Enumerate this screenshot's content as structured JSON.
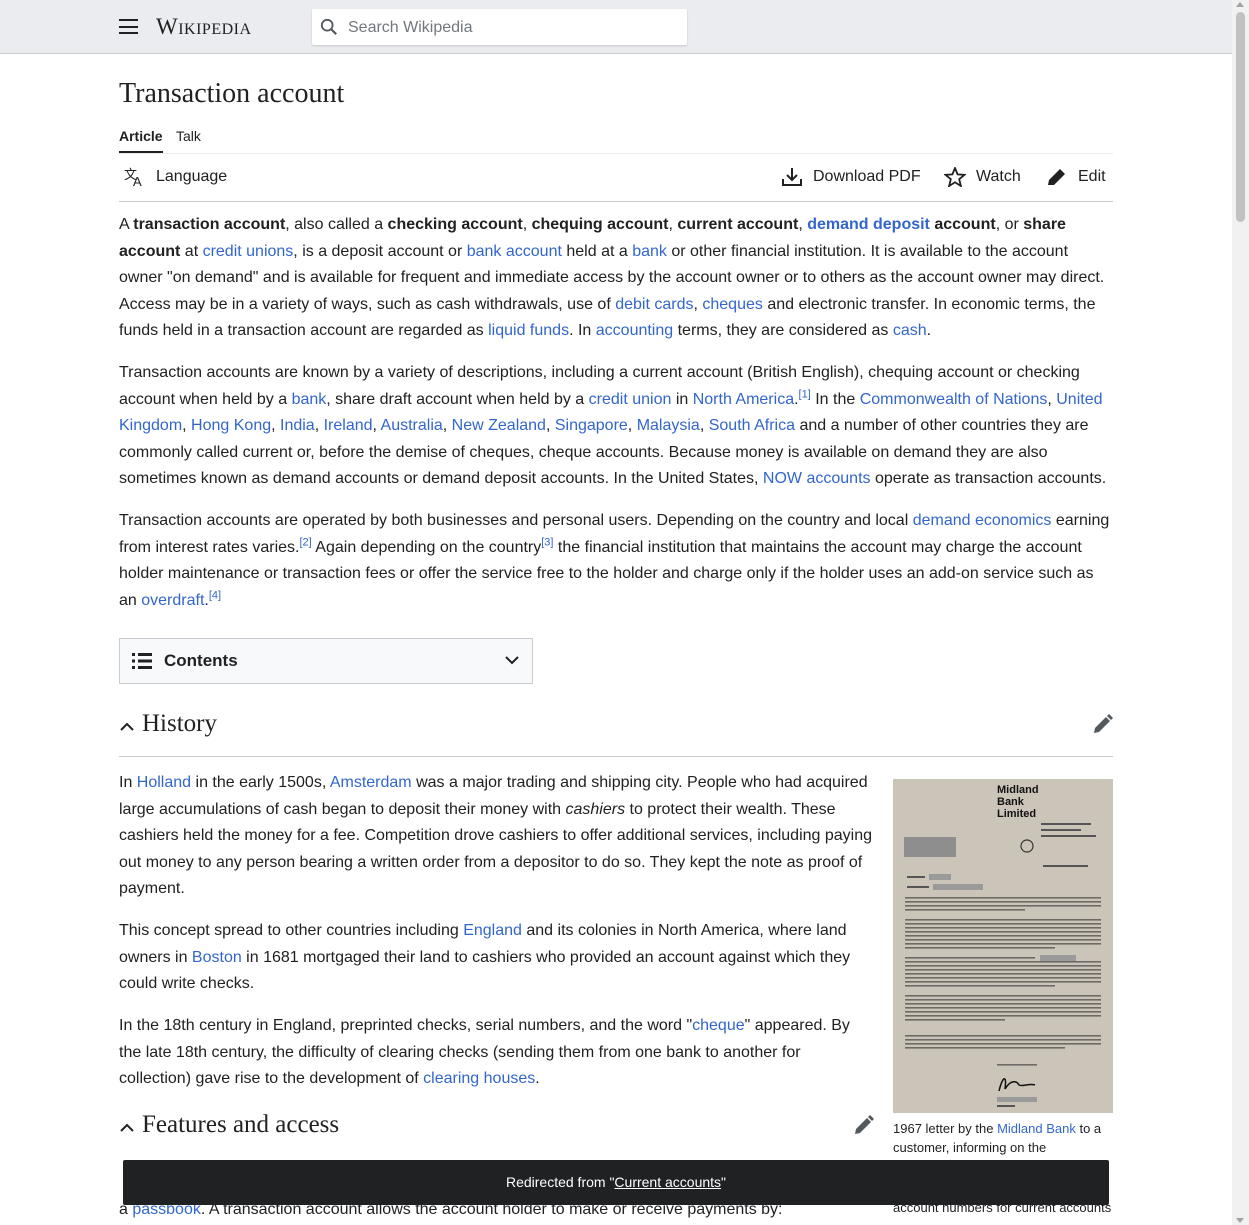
{
  "header": {
    "logo": "Wikipedia",
    "search_placeholder": "Search Wikipedia"
  },
  "page": {
    "title": "Transaction account",
    "tabs": [
      "Article",
      "Talk"
    ],
    "actions": {
      "language": "Language",
      "download": "Download PDF",
      "watch": "Watch",
      "edit": "Edit"
    }
  },
  "intro": {
    "p1": [
      {
        "t": "A "
      },
      {
        "t": "transaction account",
        "b": true
      },
      {
        "t": ", also called a "
      },
      {
        "t": "checking account",
        "b": true
      },
      {
        "t": ", "
      },
      {
        "t": "chequing account",
        "b": true
      },
      {
        "t": ", "
      },
      {
        "t": "current account",
        "b": true
      },
      {
        "t": ", "
      },
      {
        "t": "demand deposit",
        "b": true,
        "l": true
      },
      {
        "t": " account",
        "b": true
      },
      {
        "t": ", or "
      },
      {
        "t": "share account",
        "b": true
      },
      {
        "t": " at "
      },
      {
        "t": "credit unions",
        "l": true
      },
      {
        "t": ", is a deposit account or "
      },
      {
        "t": "bank account",
        "l": true
      },
      {
        "t": " held at a "
      },
      {
        "t": "bank",
        "l": true
      },
      {
        "t": " or other financial institution. It is available to the account owner \"on demand\" and is available for frequent and immediate access by the account owner or to others as the account owner may direct. Access may be in a variety of ways, such as cash withdrawals, use of "
      },
      {
        "t": "debit cards",
        "l": true
      },
      {
        "t": ", "
      },
      {
        "t": "cheques",
        "l": true
      },
      {
        "t": " and electronic transfer. In economic terms, the funds held in a transaction account are regarded as "
      },
      {
        "t": "liquid funds",
        "l": true
      },
      {
        "t": ". In "
      },
      {
        "t": "accounting",
        "l": true
      },
      {
        "t": " terms, they are considered as "
      },
      {
        "t": "cash",
        "l": true
      },
      {
        "t": "."
      }
    ],
    "p2": [
      {
        "t": "Transaction accounts are known by a variety of descriptions, including a current account (British English), chequing account or checking account when held by a "
      },
      {
        "t": "bank",
        "l": true
      },
      {
        "t": ", share draft account when held by a "
      },
      {
        "t": "credit union",
        "l": true
      },
      {
        "t": " in "
      },
      {
        "t": "North America",
        "l": true
      },
      {
        "t": ".",
        "s": false
      },
      {
        "t": "[1]",
        "sup": true
      },
      {
        "t": " In the "
      },
      {
        "t": "Commonwealth of Nations",
        "l": true
      },
      {
        "t": ", "
      },
      {
        "t": "United Kingdom",
        "l": true
      },
      {
        "t": ", "
      },
      {
        "t": "Hong Kong",
        "l": true
      },
      {
        "t": ", "
      },
      {
        "t": "India",
        "l": true
      },
      {
        "t": ", "
      },
      {
        "t": "Ireland",
        "l": true
      },
      {
        "t": ", "
      },
      {
        "t": "Australia",
        "l": true
      },
      {
        "t": ", "
      },
      {
        "t": "New Zealand",
        "l": true
      },
      {
        "t": ", "
      },
      {
        "t": "Singapore",
        "l": true
      },
      {
        "t": ", "
      },
      {
        "t": "Malaysia",
        "l": true
      },
      {
        "t": ", "
      },
      {
        "t": "South Africa",
        "l": true
      },
      {
        "t": " and a number of other countries they are commonly called current or, before the demise of cheques, cheque accounts. Because money is available on demand they are also sometimes known as demand accounts or demand deposit accounts. In the United States, "
      },
      {
        "t": "NOW accounts",
        "l": true
      },
      {
        "t": " operate as transaction accounts."
      }
    ],
    "p3": [
      {
        "t": "Transaction accounts are operated by both businesses and personal users. Depending on the country and local "
      },
      {
        "t": "demand economics",
        "l": true
      },
      {
        "t": " earning from interest rates varies."
      },
      {
        "t": "[2]",
        "sup": true
      },
      {
        "t": " Again depending on the country"
      },
      {
        "t": "[3]",
        "sup": true
      },
      {
        "t": " the financial institution that maintains the account may charge the account holder maintenance or transaction fees or offer the service free to the holder and charge only if the holder uses an add-on service such as an "
      },
      {
        "t": "overdraft",
        "l": true
      },
      {
        "t": "."
      },
      {
        "t": "[4]",
        "sup": true
      }
    ]
  },
  "toc": {
    "label": "Contents"
  },
  "history": {
    "heading": "History",
    "p1": [
      {
        "t": "In "
      },
      {
        "t": "Holland",
        "l": true
      },
      {
        "t": " in the early 1500s, "
      },
      {
        "t": "Amsterdam",
        "l": true
      },
      {
        "t": " was a major trading and shipping city. People who had acquired large accumulations of cash began to deposit their money with "
      },
      {
        "t": "cashiers",
        "i": true
      },
      {
        "t": " to protect their wealth. These cashiers held the money for a fee. Competition drove cashiers to offer additional services, including paying out money to any person bearing a written order from a depositor to do so. They kept the note as proof of payment."
      }
    ],
    "p2": [
      {
        "t": "This concept spread to other countries including "
      },
      {
        "t": "England",
        "l": true
      },
      {
        "t": " and its colonies in North America, where land owners in "
      },
      {
        "t": "Boston",
        "l": true
      },
      {
        "t": " in 1681 mortgaged their land to cashiers who provided an account against which they could write checks."
      }
    ],
    "p3": [
      {
        "t": "In the 18th century in England, preprinted checks, serial numbers, and the word \""
      },
      {
        "t": "cheque",
        "l": true
      },
      {
        "t": "\" appeared. By the late 18th century, the difficulty of clearing checks (sending them from one bank to another for collection) gave rise to the development of "
      },
      {
        "t": "clearing houses",
        "l": true
      },
      {
        "t": "."
      }
    ]
  },
  "figure": {
    "letter_title": "Midland Bank Limited",
    "caption": [
      {
        "t": "1967 letter by the "
      },
      {
        "t": "Midland Bank",
        "l": true
      },
      {
        "t": " to a customer, informing on the"
      }
    ],
    "caption_tail": "account numbers for current accounts"
  },
  "features": {
    "heading": "Features and access",
    "partial": [
      {
        "t": "a "
      },
      {
        "t": "passbook",
        "l": true
      },
      {
        "t": ". A transaction account allows the account holder to make or receive payments by:"
      }
    ]
  },
  "toast": {
    "prefix": "Redirected from \"",
    "link": "Current accounts",
    "suffix": "\""
  }
}
